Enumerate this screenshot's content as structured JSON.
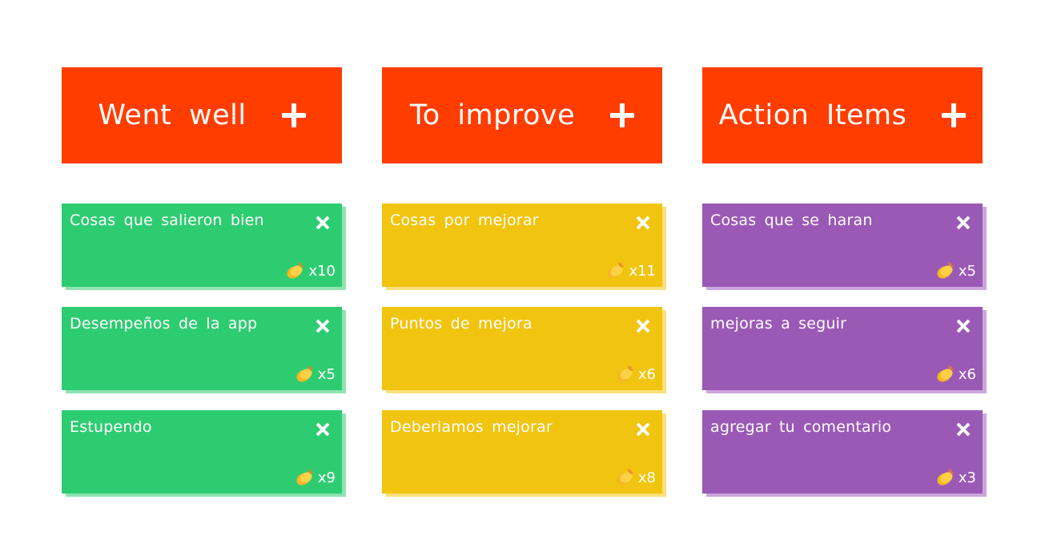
{
  "columns": [
    {
      "title": "Went well",
      "color": "green",
      "cards": [
        {
          "text": "Cosas que salieron bien",
          "claps": "x10"
        },
        {
          "text": "Desempeños de la app",
          "claps": "x5"
        },
        {
          "text": "Estupendo",
          "claps": "x9"
        }
      ]
    },
    {
      "title": "To improve",
      "color": "yellow",
      "cards": [
        {
          "text": "Cosas por mejorar",
          "claps": "x11"
        },
        {
          "text": "Puntos de mejora",
          "claps": "x6"
        },
        {
          "text": "Deberiamos mejorar",
          "claps": "x8"
        }
      ]
    },
    {
      "title": "Action Items",
      "color": "purple",
      "cards": [
        {
          "text": "Cosas que se haran",
          "claps": "x5"
        },
        {
          "text": "mejoras a seguir",
          "claps": "x6"
        },
        {
          "text": "agregar tu comentario",
          "claps": "x3"
        }
      ]
    }
  ],
  "colors": {
    "header": "#ff3d00",
    "green": "#2ecc71",
    "yellow": "#f1c40f",
    "purple": "#9b59b6"
  },
  "icons": {
    "add": "plus-icon",
    "remove": "close-icon",
    "clap": "clapping-hands-icon"
  }
}
